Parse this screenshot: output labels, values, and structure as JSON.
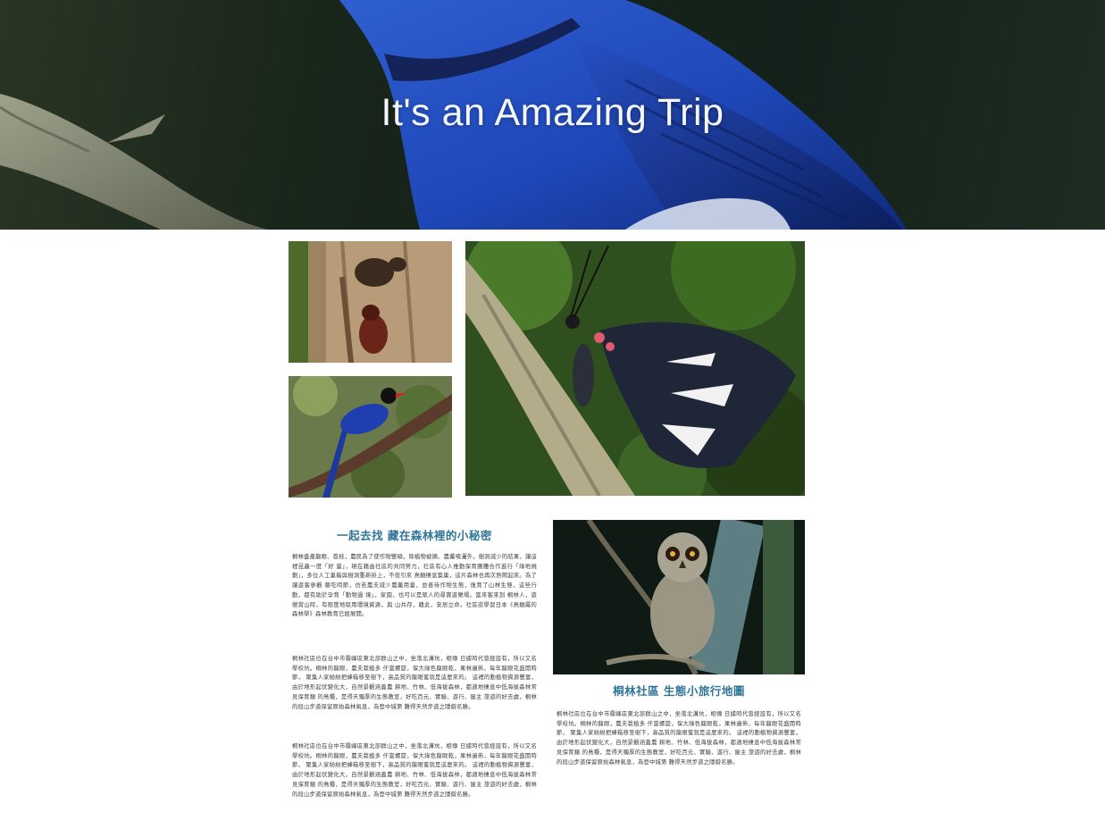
{
  "hero": {
    "title": "It's an Amazing Trip",
    "image": "blue-flycatcher-photo"
  },
  "gallery": {
    "images": [
      "beetles-on-tree-photo",
      "taiwan-blue-magpie-photo",
      "butterfly-photo",
      "owl-photo"
    ]
  },
  "article_left": {
    "heading": "一起去找 藏在森林裡的小秘密",
    "paragraphs": [
      "桐林盛產龍眼、荔枝，農民為了使作物豐碩，除植物被摘、農藥噴灑外，樹洞減少的結果，讓這裡昆蟲一度「好 量」，現在藉由社區的共同努力，社區有心人推動保育團體合作進行「綠地規劃」，多位人工巢箱與樹洞重新掛上，不但引來 鳥類棲息築巢，這片森林也再次熱鬧起來。為了讓遊客參觀 慕吃時節，仿若農夫減少農藥用量，並善待作物生態，復育了山林生態，這些行動，都有助於孕育「動物過 境」，家園，也可以是眾人的尋寶遊樂場。當來客來到 桐林人，遊憩賞山時，有限度地取用環境資源，與 山共存，藉此，安居立命。社區欲學習日本《鳥類屬的 森林學》森林教育已經展開。",
      "桐林社區位在台中市霧峰區東北部群山之中，坐落北溝坑，相傳 日據時代曾經設有，所以又名學校坑。桐林的龍眼，農夫栽植多 仟當螺旋，保大綠色龍眼乾，果林遍佈，每年龍眼花盛開時節， 聚集人家紛紛把蜂箱移至樹下，高品質的龍眼蜜就是這麼來的。 這裡的動植物資源豐富，由於地形起伏變化大，自然景觀涵蓋農 耕地、竹林、低海拔森林，都適地棲息中低海拔森林常見保育類 的鳥種，是得天獨厚的生態教室，好吃百元、實驗、遊行、屋主 旅遊的好去處，桐林的段山步道保留原始森林氣息，為登中城第 難得天然步道之隱僻名勝。",
      "桐林社區位在台中市霧峰區東北部群山之中，坐落北溝坑，相傳 日據時代曾經設有，所以又名學校坑。桐林的龍眼，農夫栽植多 仟當螺旋，保大綠色龍眼乾，果林遍佈，每年龍眼花盛開時節， 聚集人家紛紛把蜂箱移至樹下，高品質的龍眼蜜就是這麼來的。 這裡的動植物資源豐富，由於地形起伏變化大，自然景觀涵蓋農 耕地、竹林、低海拔森林，都適地棲息中低海拔森林常見保育類 的鳥種，是得天獨厚的生態教室，好吃百元、實驗、遊行、屋主 旅遊的好去處，桐林的段山步道保留原始森林氣息，為登中城第 難得天然步道之隱僻名勝。"
    ]
  },
  "article_right": {
    "heading": "桐林社區 生態小旅行地圖",
    "paragraphs": [
      "桐林社區位在台中市霧峰區東北部群山之中，坐落北溝坑，相傳 日據時代曾經設有，所以又名學校坑。桐林的龍眼，農夫栽植多 仟當螺旋，保大綠色龍眼乾，果林遍佈，每年龍眼花盛開時節， 聚集人家紛紛把蜂箱移至樹下，高品質的龍眼蜜就是這麼來的。 這裡的動植物資源豐富，由於地形起伏變化大，自然景觀涵蓋農 耕地、竹林、低海拔森林，都適地棲息中低海拔森林常見保育類 的鳥種，是得天獨厚的生態教室，好吃百元、實驗、遊行、屋主 旅遊的好去處，桐林的段山步道保留原始森林氣息，為登中城第 難得天然步道之隱僻名勝。"
    ]
  }
}
